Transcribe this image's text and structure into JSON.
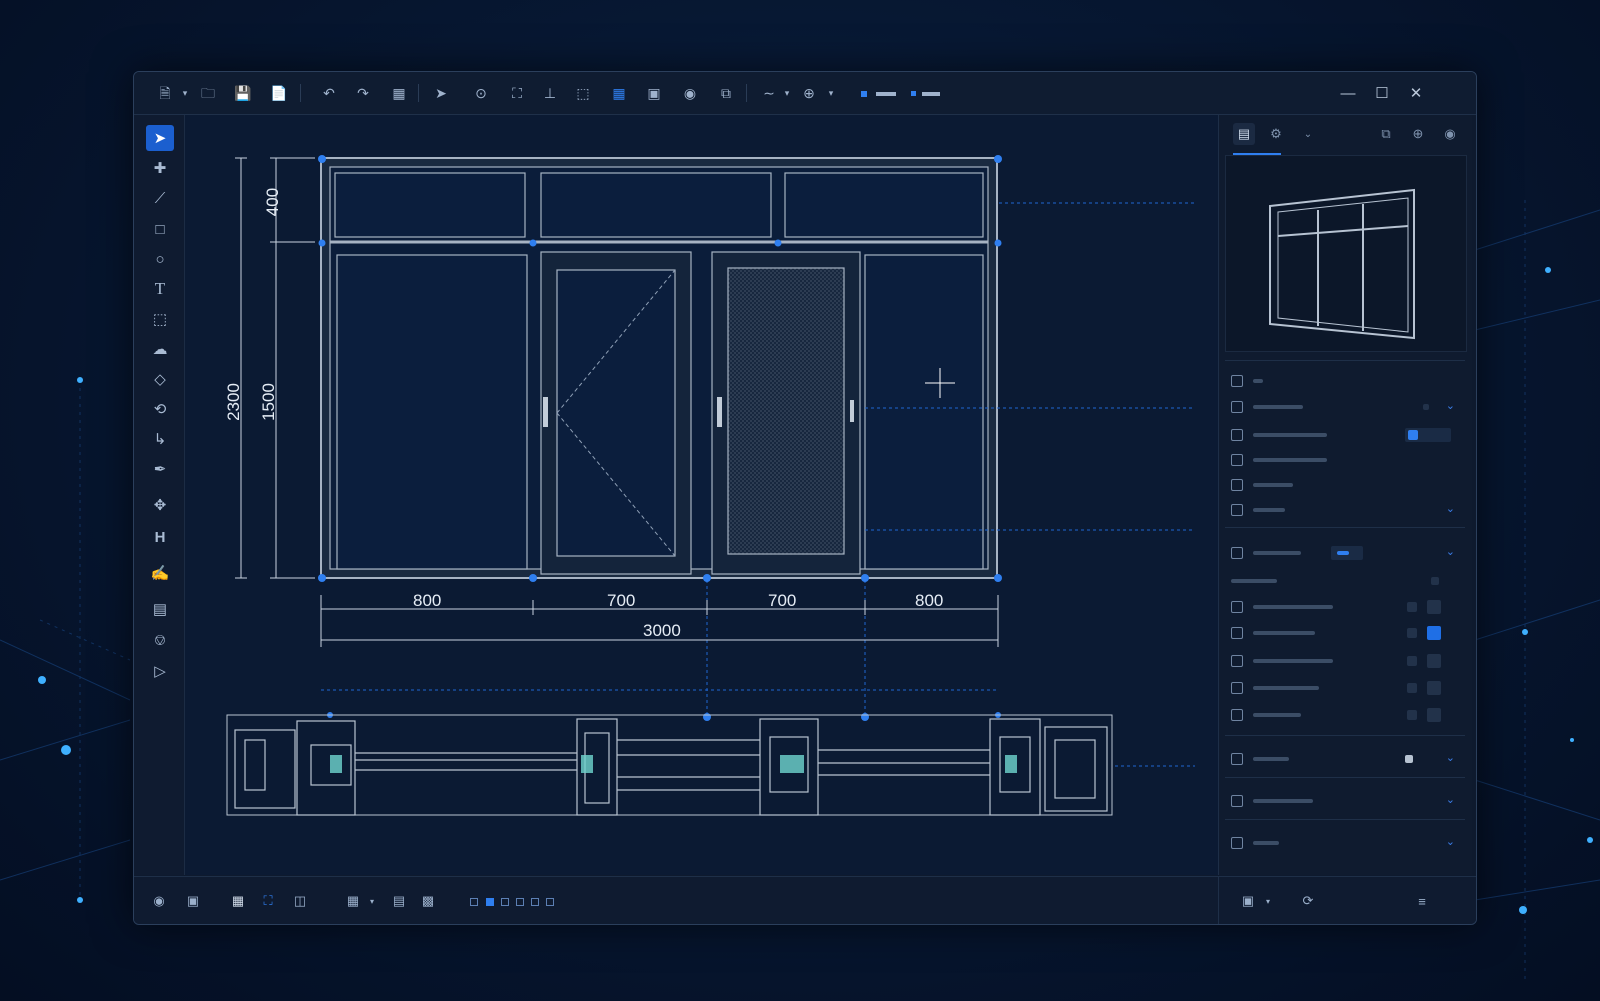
{
  "colors": {
    "accent": "#2f7ff0",
    "frame": "#9aa8ba",
    "canvas": "#0b1a33",
    "panel": "#0f1b2f"
  },
  "toolbar": {
    "icons": [
      "new-file-icon",
      "open-folder-icon",
      "save-icon",
      "document-icon",
      "undo-icon",
      "redo-icon",
      "grid-snap-icon",
      "select-icon",
      "zoom-window-icon",
      "frame-icon",
      "perpendicular-icon",
      "dotted-select-icon",
      "grid-icon",
      "zoom-extents-icon",
      "camera-icon",
      "copy-icon",
      "curve-icon",
      "target-icon"
    ]
  },
  "left_tools": [
    "select-arrow-icon",
    "crosshair-icon",
    "line-icon",
    "rectangle-icon",
    "circle-icon",
    "text-icon",
    "point-snap-icon",
    "cloud-icon",
    "eraser-icon",
    "rotate-icon",
    "bend-icon",
    "pen-icon",
    "move-icon",
    "dimension-icon",
    "paint-icon",
    "layer-icon",
    "shape-icon",
    "tag-icon"
  ],
  "drawing": {
    "dimensions": {
      "total_height": "2300",
      "transom_height": "400",
      "lower_height": "1500",
      "panel_widths": [
        "800",
        "700",
        "700",
        "800"
      ],
      "total_width": "3000"
    }
  },
  "status": {
    "pages": 6,
    "current_page": 1
  }
}
